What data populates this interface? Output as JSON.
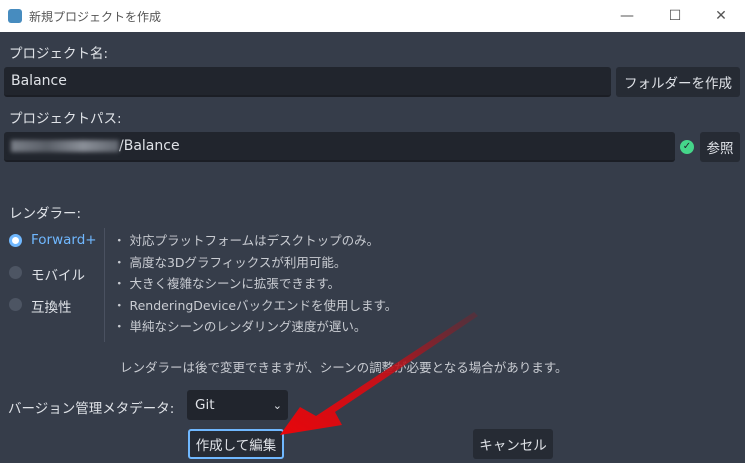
{
  "window": {
    "title": "新規プロジェクトを作成",
    "minimize": "—",
    "maximize": "☐",
    "close": "✕"
  },
  "project_name": {
    "label": "プロジェクト名:",
    "value": "Balance",
    "create_folder": "フォルダーを作成"
  },
  "project_path": {
    "label": "プロジェクトパス:",
    "value": "/Balance",
    "browse": "参照",
    "status_icon": "check-circle-icon",
    "status_color": "#45d68a"
  },
  "renderer": {
    "label": "レンダラー:",
    "options": [
      {
        "label": "Forward+",
        "selected": true
      },
      {
        "label": "モバイル",
        "selected": false
      },
      {
        "label": "互換性",
        "selected": false
      }
    ],
    "features": [
      "・ 対応プラットフォームはデスクトップのみ。",
      "・ 高度な3Dグラフィックスが利用可能。",
      "・ 大きく複雑なシーンに拡張できます。",
      "・ RenderingDeviceバックエンドを使用します。",
      "・ 単純なシーンのレンダリング速度が遅い。"
    ],
    "note": "レンダラーは後で変更できますが、シーンの調整が必要となる場合があります。"
  },
  "vcs": {
    "label": "バージョン管理メタデータ:",
    "value": "Git"
  },
  "actions": {
    "create": "作成して編集",
    "cancel": "キャンセル"
  },
  "colors": {
    "accent": "#70b8ff",
    "arrow": "#e0151a"
  }
}
